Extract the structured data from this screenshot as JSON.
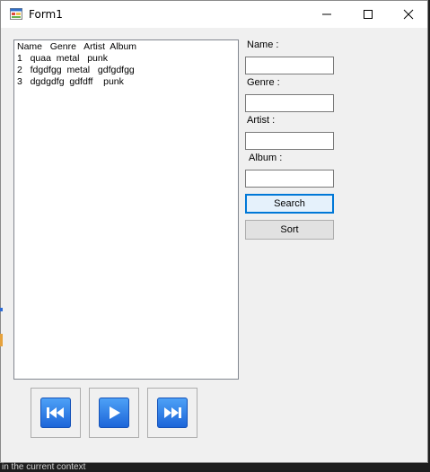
{
  "window": {
    "title": "Form1",
    "minimize_icon": "minimize-icon",
    "maximize_icon": "maximize-icon",
    "close_icon": "close-icon"
  },
  "listbox": {
    "header": "Name   Genre   Artist  Album",
    "rows": [
      "1   quaa  metal   punk",
      "2   fdgdfgg  metal   gdfgdfgg",
      "3   dgdgdfg  gdfdff    punk"
    ]
  },
  "form": {
    "name_label": "Name :",
    "genre_label": "Genre :",
    "artist_label": "Artist :",
    "album_label": "Album :",
    "name_value": "",
    "genre_value": "",
    "artist_value": "",
    "album_value": "",
    "search_label": "Search",
    "sort_label": "Sort"
  },
  "media": {
    "previous_icon": "skip-previous-icon",
    "play_icon": "play-icon",
    "next_icon": "skip-next-icon"
  },
  "background": {
    "status_text": "in the current context"
  }
}
